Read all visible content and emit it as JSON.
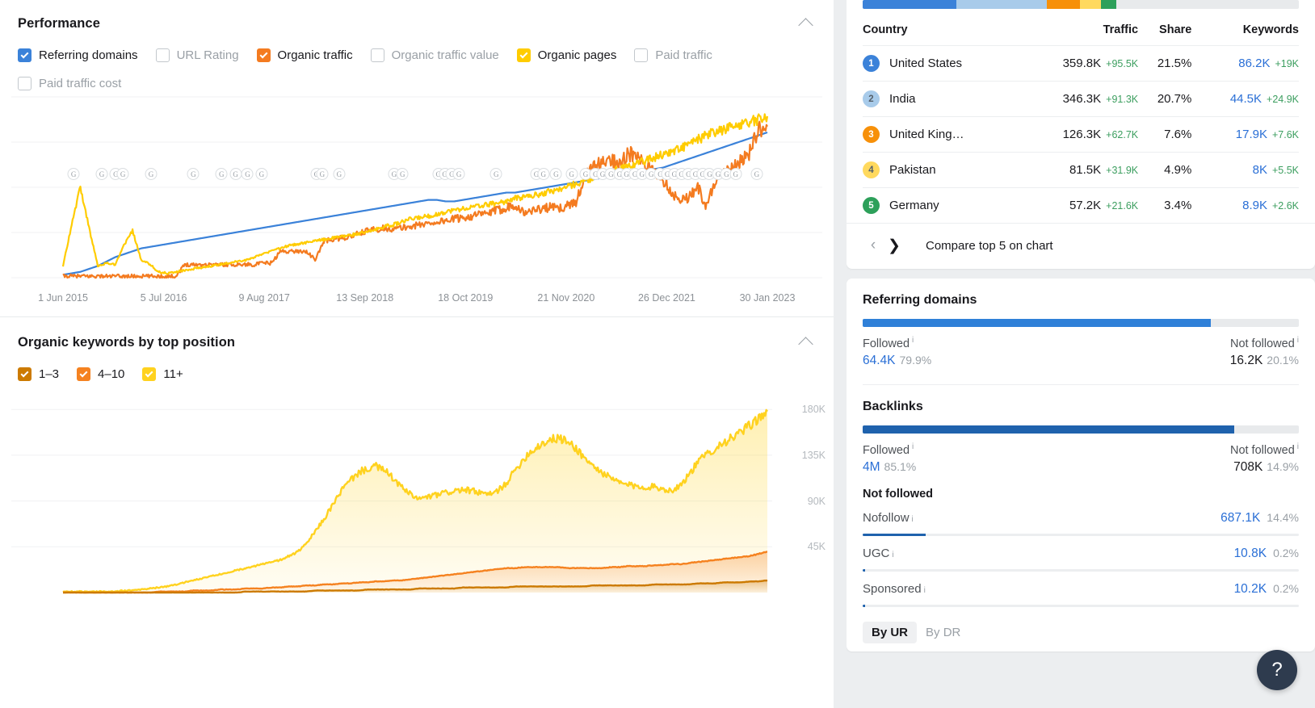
{
  "performance": {
    "title": "Performance",
    "collapse_icon": "chevron-up-icon",
    "legend": [
      {
        "label": "Referring domains",
        "checked": true,
        "color": "#3b82d9"
      },
      {
        "label": "URL Rating",
        "checked": false,
        "color": "#c3c8cd"
      },
      {
        "label": "Organic traffic",
        "checked": true,
        "color": "#f47b20"
      },
      {
        "label": "Organic traffic value",
        "checked": false,
        "color": "#c3c8cd"
      },
      {
        "label": "Organic pages",
        "checked": true,
        "color": "#ffcc00"
      },
      {
        "label": "Paid traffic",
        "checked": false,
        "color": "#c3c8cd"
      },
      {
        "label": "Paid traffic cost",
        "checked": false,
        "color": "#c3c8cd"
      }
    ],
    "x_ticks": [
      "1 Jun 2015",
      "5 Jul 2016",
      "9 Aug 2017",
      "13 Sep 2018",
      "18 Oct 2019",
      "21 Nov 2020",
      "26 Dec 2021",
      "30 Jan 2023"
    ]
  },
  "keywords_section": {
    "title": "Organic keywords by top position",
    "collapse_icon": "chevron-up-icon",
    "legend": [
      {
        "label": "1–3",
        "checked": true,
        "color": "#cc7a00"
      },
      {
        "label": "4–10",
        "checked": true,
        "color": "#f58220"
      },
      {
        "label": "11+",
        "checked": true,
        "color": "#ffd21f"
      }
    ],
    "y_ticks": [
      "180K",
      "135K",
      "90K",
      "45K"
    ]
  },
  "chart_data": [
    {
      "type": "line",
      "title": "Performance",
      "xlabel": "",
      "ylabel": "",
      "x_ticks": [
        "1 Jun 2015",
        "5 Jul 2016",
        "9 Aug 2017",
        "13 Sep 2018",
        "18 Oct 2019",
        "21 Nov 2020",
        "26 Dec 2021",
        "30 Jan 2023"
      ],
      "grid": true,
      "legend_position": "top",
      "series": [
        {
          "name": "Referring domains",
          "color": "#3b82d9",
          "values": [
            2,
            3,
            4,
            6,
            8,
            11,
            14,
            16,
            18,
            20,
            21,
            22,
            23,
            24,
            25,
            26,
            27,
            28,
            29,
            30,
            31,
            32,
            33,
            34,
            35,
            36,
            37,
            38,
            39,
            40,
            41,
            42,
            43,
            44,
            45,
            46,
            47,
            48,
            49,
            50,
            51,
            52,
            53,
            53,
            52,
            52,
            53,
            54,
            55,
            56,
            57,
            58,
            58,
            59,
            60,
            61,
            62,
            63,
            64,
            65,
            66,
            67,
            68,
            69,
            70,
            71,
            72,
            73,
            74,
            75,
            77,
            79,
            81,
            83,
            85,
            87,
            89,
            91,
            93,
            95,
            97,
            99
          ]
        },
        {
          "name": "Organic traffic",
          "color": "#f47b20",
          "values": [
            1,
            1,
            1,
            1,
            1,
            1,
            1,
            1,
            1,
            1,
            1,
            1,
            1,
            1,
            9,
            9,
            9,
            9,
            9,
            9,
            9,
            9,
            9,
            10,
            10,
            18,
            18,
            18,
            18,
            12,
            25,
            26,
            27,
            28,
            30,
            32,
            33,
            34,
            33,
            34,
            35,
            36,
            37,
            38,
            39,
            40,
            41,
            42,
            43,
            44,
            46,
            48,
            50,
            44,
            46,
            47,
            48,
            47,
            49,
            52,
            68,
            76,
            78,
            80,
            79,
            84,
            83,
            75,
            72,
            67,
            58,
            53,
            55,
            62,
            48,
            67,
            70,
            74,
            80,
            86,
            100,
            103
          ]
        },
        {
          "name": "Organic pages",
          "color": "#ffcc00",
          "values": [
            8,
            36,
            62,
            34,
            8,
            10,
            9,
            22,
            32,
            12,
            9,
            4,
            3,
            4,
            5,
            6,
            7,
            8,
            9,
            10,
            11,
            12,
            14,
            16,
            18,
            20,
            22,
            23,
            24,
            25,
            26,
            27,
            28,
            29,
            30,
            31,
            33,
            35,
            36,
            38,
            40,
            41,
            42,
            43,
            45,
            46,
            47,
            48,
            49,
            50,
            51,
            52,
            54,
            55,
            56,
            57,
            59,
            60,
            62,
            64,
            66,
            68,
            70,
            72,
            74,
            76,
            78,
            80,
            82,
            84,
            86,
            88,
            91,
            94,
            97,
            99,
            101,
            103,
            105,
            106,
            108,
            110
          ]
        }
      ]
    },
    {
      "type": "area",
      "title": "Organic keywords by top position",
      "y_ticks": [
        180000,
        135000,
        90000,
        45000
      ],
      "ylim": [
        0,
        200000
      ],
      "grid": true,
      "legend_position": "top",
      "series": [
        {
          "name": "11+",
          "color": "#ffd21f",
          "values": [
            1,
            1,
            1,
            1,
            1,
            1,
            1,
            2,
            2,
            3,
            4,
            5,
            6,
            8,
            10,
            12,
            14,
            16,
            18,
            20,
            22,
            24,
            26,
            28,
            30,
            32,
            36,
            40,
            48,
            60,
            72,
            86,
            100,
            110,
            118,
            122,
            124,
            120,
            112,
            103,
            96,
            92,
            94,
            96,
            98,
            100,
            101,
            100,
            98,
            96,
            100,
            108,
            120,
            132,
            140,
            146,
            150,
            152,
            148,
            142,
            132,
            124,
            118,
            112,
            108,
            106,
            104,
            104,
            104,
            102,
            100,
            106,
            116,
            128,
            136,
            142,
            148,
            152,
            158,
            164,
            172,
            178
          ]
        },
        {
          "name": "4–10",
          "color": "#f58220",
          "values": [
            0,
            0,
            0,
            0,
            0,
            0,
            0,
            0,
            0,
            0,
            0,
            1,
            1,
            1,
            1,
            2,
            2,
            2,
            3,
            3,
            3,
            4,
            4,
            4,
            5,
            5,
            6,
            6,
            7,
            7,
            8,
            8,
            9,
            9,
            10,
            10,
            11,
            11,
            12,
            12,
            13,
            14,
            15,
            16,
            17,
            18,
            19,
            20,
            21,
            22,
            23,
            24,
            24,
            25,
            25,
            25,
            25,
            25,
            24,
            24,
            24,
            24,
            24,
            25,
            25,
            26,
            26,
            26,
            27,
            27,
            28,
            28,
            29,
            30,
            31,
            32,
            33,
            34,
            35,
            36,
            38,
            40
          ]
        },
        {
          "name": "1–3",
          "color": "#cc7a00",
          "values": [
            0,
            0,
            0,
            0,
            0,
            0,
            0,
            0,
            0,
            0,
            0,
            0,
            0,
            0,
            0,
            0,
            0,
            0,
            0,
            0,
            0,
            1,
            1,
            1,
            1,
            1,
            1,
            1,
            1,
            2,
            2,
            2,
            2,
            2,
            2,
            3,
            3,
            3,
            3,
            3,
            3,
            4,
            4,
            4,
            4,
            4,
            5,
            5,
            5,
            5,
            5,
            5,
            6,
            6,
            6,
            6,
            6,
            6,
            6,
            6,
            6,
            7,
            7,
            7,
            7,
            7,
            7,
            7,
            8,
            8,
            8,
            8,
            8,
            9,
            9,
            9,
            10,
            10,
            10,
            11,
            11,
            12
          ]
        }
      ]
    }
  ],
  "countries": {
    "share_bar": [
      {
        "color": "#3b82d9",
        "pct": 21.5
      },
      {
        "color": "#a8cbea",
        "pct": 20.7
      },
      {
        "color": "#f79009",
        "pct": 7.6
      },
      {
        "color": "#ffd95e",
        "pct": 4.9
      },
      {
        "color": "#2da05a",
        "pct": 3.4
      },
      {
        "color": "#e8eaec",
        "pct": 41.9
      }
    ],
    "headers": [
      "Country",
      "Traffic",
      "Share",
      "Keywords"
    ],
    "rows": [
      {
        "rank": "1",
        "rank_color": "#3b82d9",
        "name": "United States",
        "traffic": "359.8K",
        "traffic_delta": "+95.5K",
        "share": "21.5%",
        "keywords": "86.2K",
        "keywords_delta": "+19K"
      },
      {
        "rank": "2",
        "rank_color": "#a8cbea",
        "name": "India",
        "traffic": "346.3K",
        "traffic_delta": "+91.3K",
        "share": "20.7%",
        "keywords": "44.5K",
        "keywords_delta": "+24.9K"
      },
      {
        "rank": "3",
        "rank_color": "#f79009",
        "name": "United King…",
        "traffic": "126.3K",
        "traffic_delta": "+62.7K",
        "share": "7.6%",
        "keywords": "17.9K",
        "keywords_delta": "+7.6K"
      },
      {
        "rank": "4",
        "rank_color": "#ffd95e",
        "name": "Pakistan",
        "traffic": "81.5K",
        "traffic_delta": "+31.9K",
        "share": "4.9%",
        "keywords": "8K",
        "keywords_delta": "+5.5K"
      },
      {
        "rank": "5",
        "rank_color": "#2da05a",
        "name": "Germany",
        "traffic": "57.2K",
        "traffic_delta": "+21.6K",
        "share": "3.4%",
        "keywords": "8.9K",
        "keywords_delta": "+2.6K"
      }
    ],
    "prev_icon": "chevron-left-icon",
    "next_icon": "chevron-right-icon",
    "compare_label": "Compare top 5 on chart"
  },
  "referring_domains": {
    "title": "Referring domains",
    "bar_fill_pct": 79.9,
    "bar_color": "#2f80d8",
    "followed_label": "Followed",
    "followed_value": "64.4K",
    "followed_pct": "79.9%",
    "notfollowed_label": "Not followed",
    "notfollowed_value": "16.2K",
    "notfollowed_pct": "20.1%"
  },
  "backlinks": {
    "title": "Backlinks",
    "bar_fill_pct": 85.1,
    "bar_color": "#1f62ad",
    "followed_label": "Followed",
    "followed_value": "4M",
    "followed_pct": "85.1%",
    "notfollowed_label": "Not followed",
    "notfollowed_value": "708K",
    "notfollowed_pct": "14.9%",
    "not_followed_title": "Not followed",
    "breakdown": [
      {
        "label": "Nofollow",
        "value": "687.1K",
        "pct": "14.4%",
        "bar_pct": 14.4
      },
      {
        "label": "UGC",
        "value": "10.8K",
        "pct": "0.2%",
        "bar_pct": 0.6
      },
      {
        "label": "Sponsored",
        "value": "10.2K",
        "pct": "0.2%",
        "bar_pct": 0.5
      }
    ],
    "tabs": [
      {
        "label": "By UR",
        "active": true
      },
      {
        "label": "By DR",
        "active": false
      }
    ]
  },
  "help_button": {
    "glyph": "?"
  }
}
